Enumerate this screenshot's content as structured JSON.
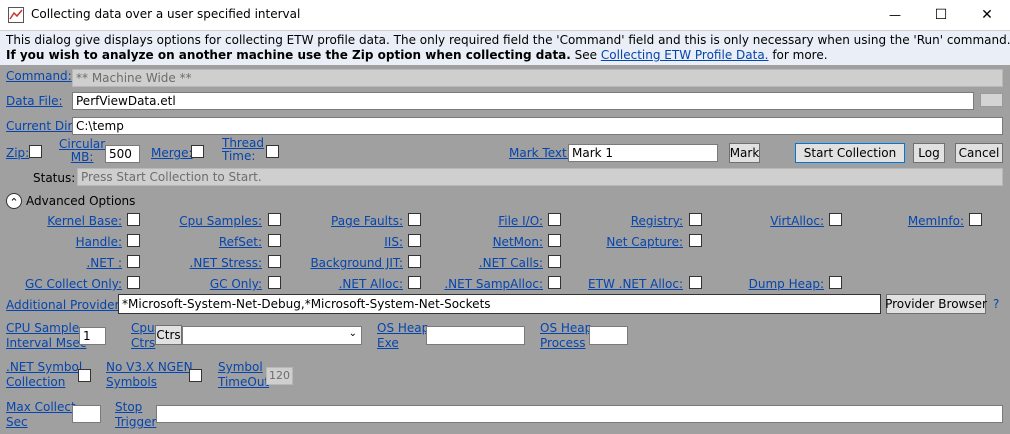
{
  "window": {
    "title": "Collecting data over a user specified interval",
    "minimize_glyph": "—",
    "maximize_glyph": "☐",
    "close_glyph": "✕"
  },
  "info": {
    "line1": "This dialog give displays options for collecting ETW profile data. The only required field the 'Command' field and this is only necessary when using the 'Run' command.",
    "line2_bold": "If you wish to analyze on another machine use the Zip option when collecting data.",
    "line2_see": " See ",
    "line2_link": "Collecting ETW Profile Data.",
    "line2_after": " for more."
  },
  "form": {
    "command_label": "Command:",
    "command_value": "** Machine Wide **",
    "datafile_label": "Data File:",
    "datafile_value": "PerfViewData.etl",
    "curdir_label": "Current Dir:",
    "curdir_value": "C:\\temp",
    "zip_label": "Zip:",
    "circular_label_1": "Circular",
    "circular_label_2": "MB:",
    "circular_value": "500",
    "merge_label": "Merge:",
    "thread_label_1": "Thread",
    "thread_label_2": "Time:",
    "marktext_label": "Mark Text:",
    "marktext_value": "Mark 1",
    "mark_button": "Mark",
    "start_button": "Start Collection",
    "log_button": "Log",
    "cancel_button": "Cancel",
    "status_label": "Status:",
    "status_value": "Press Start Collection to Start.",
    "advanced_label": "Advanced Options",
    "advanced_icon": "⌃"
  },
  "providers": {
    "row1": [
      "Kernel Base:",
      "Cpu Samples:",
      "Page Faults:",
      "File I/O:",
      "Registry:",
      "VirtAlloc:",
      "MemInfo:"
    ],
    "row2": [
      "Handle:",
      "RefSet:",
      "IIS:",
      "NetMon:",
      "Net Capture:"
    ],
    "row3": [
      ".NET :",
      ".NET Stress:",
      "Background JIT:",
      ".NET Calls:"
    ],
    "row4": [
      "GC Collect Only:",
      "GC Only:",
      ".NET Alloc:",
      ".NET SampAlloc:",
      "ETW .NET Alloc:",
      "Dump Heap:"
    ]
  },
  "additional": {
    "label": "Additional Providers:",
    "value": "*Microsoft-System-Net-Debug,*Microsoft-System-Net-Sockets",
    "browser_button": "Provider Browser",
    "help": "?"
  },
  "lower": {
    "cpu_sample_1": "CPU Sample",
    "cpu_sample_2": "Interval Msec",
    "cpu_sample_value": "1",
    "cpu_ctrs_1": "Cpu",
    "cpu_ctrs_2": "Ctrs",
    "ctrs_button": "Ctrs",
    "osheap_exe_1": "OS Heap",
    "osheap_exe_2": "Exe",
    "osheap_proc_1": "OS Heap",
    "osheap_proc_2": "Process",
    "netsym_1": ".NET Symbol",
    "netsym_2": "Collection",
    "ngen_1": "No V3.X NGEN",
    "ngen_2": "Symbols",
    "symtimeout_1": "Symbol",
    "symtimeout_2": "TimeOut",
    "symtimeout_value": "120",
    "maxcollect_1": "Max Collect",
    "maxcollect_2": "Sec",
    "stop_1": "Stop",
    "stop_2": "Trigger"
  }
}
